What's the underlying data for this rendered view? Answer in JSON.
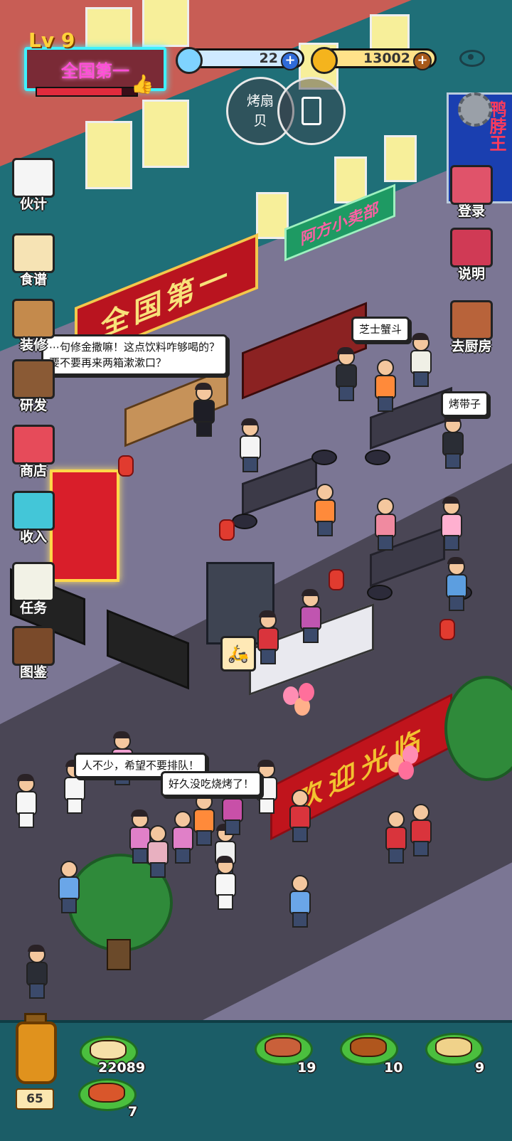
{
  "hud": {
    "level": "Lv 9",
    "title": "全国第一",
    "level_progress": 0.85,
    "gems": "22",
    "coins": "13002",
    "round_btn_1": "烤扇贝",
    "round_btn_2_icon": "phone-lock-icon",
    "settings_icon": "gear-icon",
    "eye_icon": "eye-icon"
  },
  "side_left": [
    {
      "label": "伙计",
      "icon": "chef-icon",
      "color": "#f5f5f5"
    },
    {
      "label": "食谱",
      "icon": "skewer-plate-icon",
      "color": "#f6e3b4"
    },
    {
      "label": "装修",
      "icon": "table-icon",
      "color": "#c48a4c"
    },
    {
      "label": "研发",
      "icon": "drumstick-icon",
      "color": "#8a5a35"
    },
    {
      "label": "商店",
      "icon": "shop-icon",
      "color": "#e64b5a"
    },
    {
      "label": "收入",
      "icon": "chart-icon",
      "color": "#43c6d8"
    },
    {
      "label": "任务",
      "icon": "notepad-icon",
      "color": "#f2f2e6"
    },
    {
      "label": "图鉴",
      "icon": "book-icon",
      "color": "#7a4a2a"
    }
  ],
  "side_right": [
    {
      "label": "登录",
      "icon": "calendar-icon",
      "color": "#e0536a"
    },
    {
      "label": "说明",
      "icon": "manual-icon",
      "color": "#d03a55"
    },
    {
      "label": "去厨房",
      "icon": "door-icon",
      "color": "#b8633a"
    }
  ],
  "scene": {
    "sign_main": "全国第一",
    "sign_shop": "阿方小卖部",
    "sign_right": "鸭脖王",
    "welcome_banner": "欢迎光临"
  },
  "bubbles": {
    "b1": "⋯句修金撒嘛！这点饮料咋够喝的？\n要不要再来两箱漱漱口？",
    "b2": "芝士蟹斗",
    "b3": "烤带子",
    "b4": "人不少，希望不要排队！",
    "b5": "好久没吃烧烤了！"
  },
  "bottom": {
    "jar_count": "65",
    "foods": [
      {
        "count": "22089",
        "icon": "scallop-dish-icon",
        "color": "#f5e0a8"
      },
      {
        "count": "19",
        "icon": "roast-leg-icon",
        "color": "#c9603a"
      },
      {
        "count": "10",
        "icon": "grilled-fish-icon",
        "color": "#b0561d"
      },
      {
        "count": "9",
        "icon": "cheese-crab-icon",
        "color": "#f0d28a"
      },
      {
        "count": "7",
        "icon": "chicken-leg-icon",
        "color": "#d9562b"
      }
    ]
  }
}
